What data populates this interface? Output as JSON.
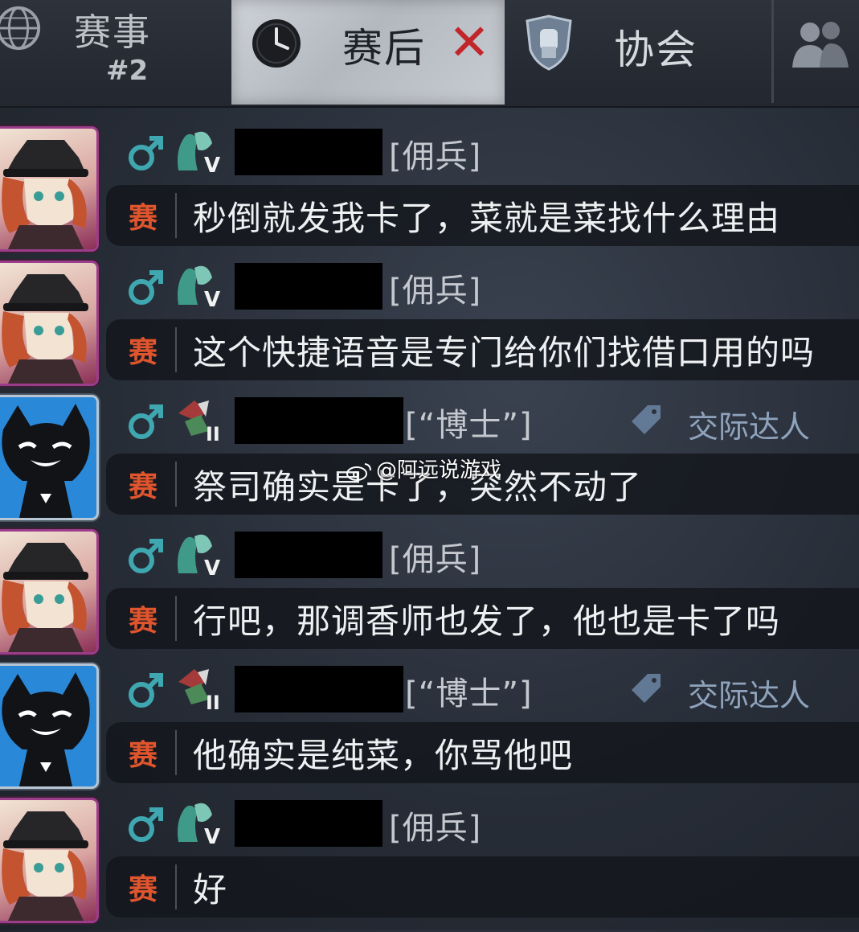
{
  "tabs": {
    "events": {
      "label": "赛事",
      "count": "#2"
    },
    "post_match": {
      "label": "赛后",
      "close": "✕"
    },
    "association": {
      "label": "协会"
    }
  },
  "messages": [
    {
      "avatar": "hat-character-avatar",
      "gender": "♂",
      "rank_icon": "rank-v",
      "role": "[佣兵]",
      "title": "",
      "channel": "赛",
      "text": "秒倒就发我卡了，菜就是菜找什么理由"
    },
    {
      "avatar": "hat-character-avatar",
      "gender": "♂",
      "rank_icon": "rank-v",
      "role": "[佣兵]",
      "title": "",
      "channel": "赛",
      "text": "这个快捷语音是专门给你们找借口用的吗"
    },
    {
      "avatar": "black-cat-avatar",
      "gender": "♂",
      "rank_icon": "rank-ii",
      "role": "[“博士”]",
      "title": "交际达人",
      "channel": "赛",
      "text": "祭司确实是卡了，突然不动了"
    },
    {
      "avatar": "hat-character-avatar",
      "gender": "♂",
      "rank_icon": "rank-v",
      "role": "[佣兵]",
      "title": "",
      "channel": "赛",
      "text": "行吧，那调香师也发了，他也是卡了吗"
    },
    {
      "avatar": "black-cat-avatar",
      "gender": "♂",
      "rank_icon": "rank-ii",
      "role": "[“博士”]",
      "title": "交际达人",
      "channel": "赛",
      "text": "他确实是纯菜，你骂他吧"
    },
    {
      "avatar": "hat-character-avatar",
      "gender": "♂",
      "rank_icon": "rank-v",
      "role": "[佣兵]",
      "title": "",
      "channel": "赛",
      "text": "好"
    }
  ],
  "rank_marks": {
    "rank-v": "V",
    "rank-ii": "II"
  },
  "watermark": "@阿远说游戏",
  "colors": {
    "channel": "#e0552d",
    "gender": "#3fa7b0",
    "close": "#c1262b",
    "title": "#8fa3bd"
  }
}
